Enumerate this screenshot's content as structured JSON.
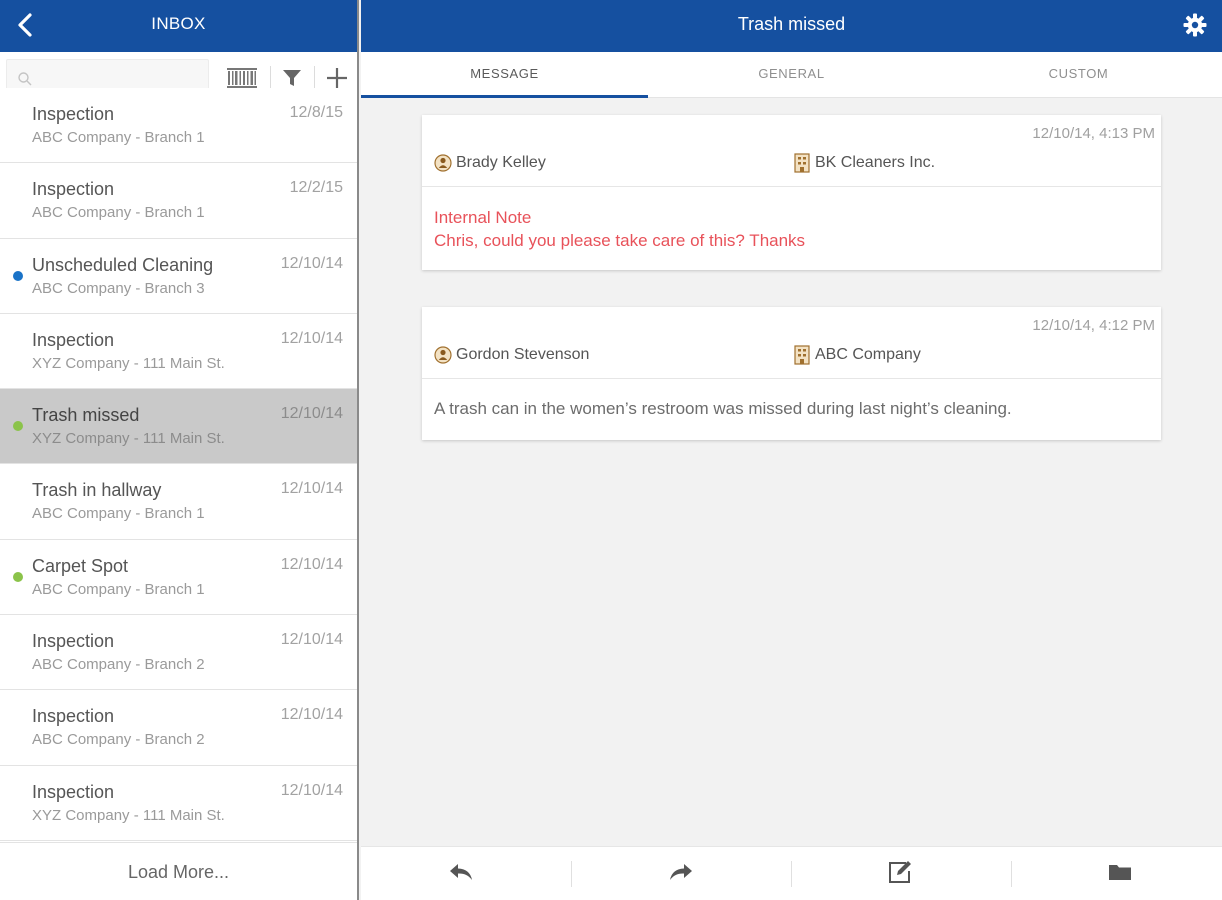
{
  "left_header": {
    "title": "INBOX"
  },
  "search": {
    "placeholder": ""
  },
  "inbox_items": [
    {
      "title": "Inspection",
      "subtitle": "ABC Company - Branch 1",
      "date": "12/8/15",
      "dot": "",
      "selected": false
    },
    {
      "title": "Inspection",
      "subtitle": "ABC Company - Branch 1",
      "date": "12/2/15",
      "dot": "",
      "selected": false
    },
    {
      "title": "Unscheduled Cleaning",
      "subtitle": "ABC Company - Branch 3",
      "date": "12/10/14",
      "dot": "#1a73c8",
      "selected": false
    },
    {
      "title": "Inspection",
      "subtitle": "XYZ Company - 111 Main St.",
      "date": "12/10/14",
      "dot": "",
      "selected": false
    },
    {
      "title": "Trash missed",
      "subtitle": "XYZ Company - 111 Main St.",
      "date": "12/10/14",
      "dot": "#8bc34a",
      "selected": true
    },
    {
      "title": "Trash in hallway",
      "subtitle": "ABC Company - Branch 1",
      "date": "12/10/14",
      "dot": "",
      "selected": false
    },
    {
      "title": "Carpet Spot",
      "subtitle": "ABC Company - Branch 1",
      "date": "12/10/14",
      "dot": "#8bc34a",
      "selected": false
    },
    {
      "title": "Inspection",
      "subtitle": "ABC Company - Branch 2",
      "date": "12/10/14",
      "dot": "",
      "selected": false
    },
    {
      "title": "Inspection",
      "subtitle": "ABC Company - Branch 2",
      "date": "12/10/14",
      "dot": "",
      "selected": false
    },
    {
      "title": "Inspection",
      "subtitle": "XYZ Company - 111 Main St.",
      "date": "12/10/14",
      "dot": "",
      "selected": false
    }
  ],
  "load_more_label": "Load More...",
  "right_header": {
    "title": "Trash missed"
  },
  "tabs": [
    {
      "label": "MESSAGE",
      "active": true
    },
    {
      "label": "GENERAL",
      "active": false
    },
    {
      "label": "CUSTOM",
      "active": false
    }
  ],
  "messages": [
    {
      "timestamp": "12/10/14, 4:13 PM",
      "person": "Brady Kelley",
      "company": "BK Cleaners Inc.",
      "note_title": "Internal Note",
      "body": "Chris, could you please take care of this? Thanks",
      "is_note": true
    },
    {
      "timestamp": "12/10/14, 4:12 PM",
      "person": "Gordon Stevenson",
      "company": "ABC Company",
      "note_title": "",
      "body": "A trash can in the women’s restroom was missed during last night’s cleaning.",
      "is_note": false
    }
  ],
  "colors": {
    "header_blue": "#1550a0",
    "note_red": "#e8525a",
    "dot_blue": "#1a73c8",
    "dot_green": "#8bc34a",
    "selected_row": "#c9c9c9"
  },
  "icons": {
    "back": "chevron-left-icon",
    "search": "search-icon",
    "barcode": "barcode-icon",
    "filter": "filter-icon",
    "add": "plus-icon",
    "settings": "gear-icon",
    "person": "person-icon",
    "company": "building-icon",
    "reply": "reply-icon",
    "forward": "forward-icon",
    "compose": "edit-icon",
    "folder": "folder-icon"
  }
}
